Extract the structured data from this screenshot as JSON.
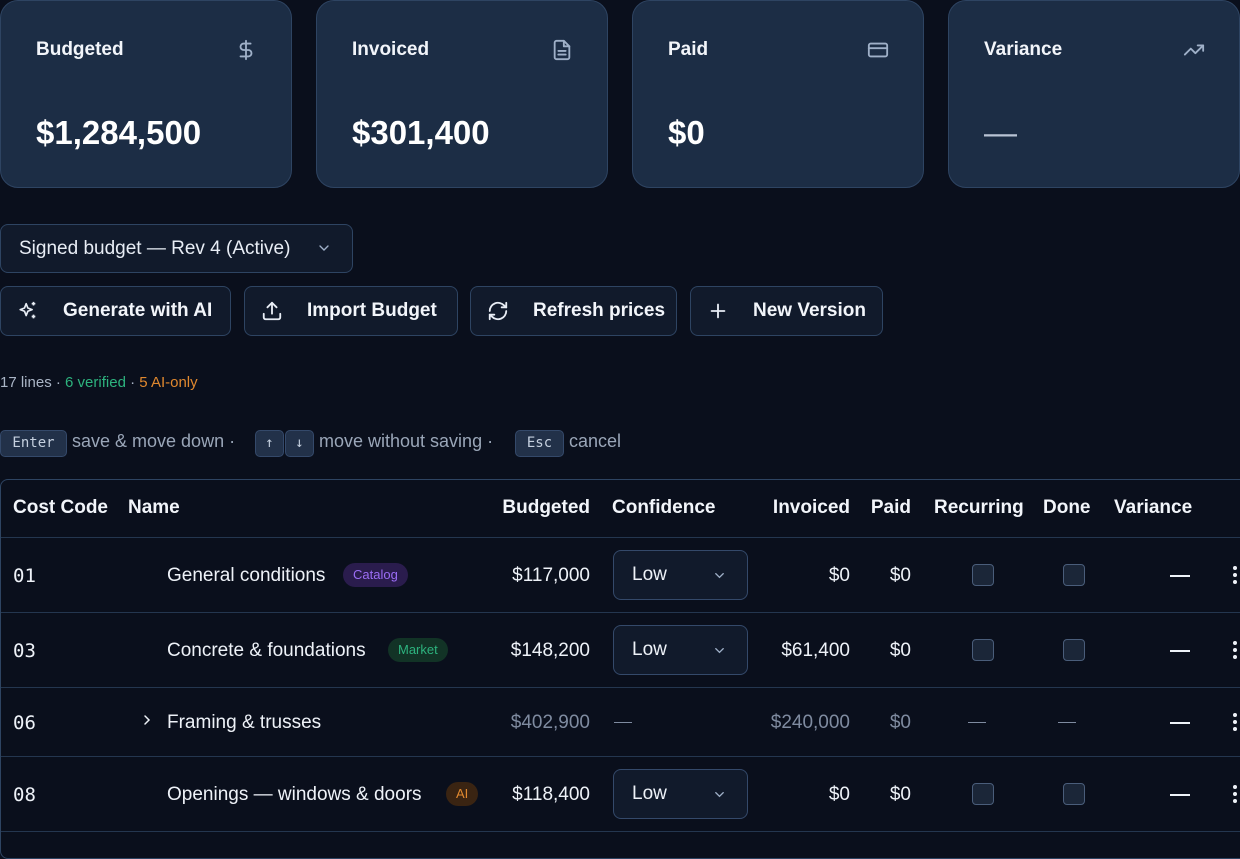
{
  "cards": [
    {
      "title": "Budgeted",
      "value": "$1,284,500",
      "icon": "dollar-icon"
    },
    {
      "title": "Invoiced",
      "value": "$301,400",
      "icon": "document-icon"
    },
    {
      "title": "Paid",
      "value": "$0",
      "icon": "credit-card-icon"
    },
    {
      "title": "Variance",
      "value": "—",
      "icon": "trending-up-icon"
    }
  ],
  "version_select": {
    "value": "Signed budget — Rev 4 (Active)"
  },
  "toolbar": {
    "generate": "Generate with AI",
    "import": "Import Budget",
    "refresh": "Refresh prices",
    "new_version": "New Version"
  },
  "summary": {
    "lines": "17 lines",
    "sep": " · ",
    "verified": "6 verified",
    "ai_only": "5 AI-only"
  },
  "hints": {
    "enter_key": "Enter",
    "enter_text": "save & move down ·",
    "up_key": "↑",
    "down_key": "↓",
    "move_text": "move without saving ·",
    "esc_key": "Esc",
    "esc_text": "cancel"
  },
  "table": {
    "headers": {
      "cost_code": "Cost Code",
      "name": "Name",
      "budgeted": "Budgeted",
      "confidence": "Confidence",
      "invoiced": "Invoiced",
      "paid": "Paid",
      "recurring": "Recurring",
      "done": "Done",
      "variance": "Variance"
    },
    "rows": [
      {
        "code": "01",
        "name": "General conditions",
        "badge": "Catalog",
        "budgeted": "$117,000",
        "confidence": "Low",
        "invoiced": "$0",
        "paid": "$0",
        "recurring": false,
        "done": false,
        "variance": "—"
      },
      {
        "code": "03",
        "name": "Concrete & foundations",
        "badge": "Market",
        "budgeted": "$148,200",
        "confidence": "Low",
        "invoiced": "$61,400",
        "paid": "$0",
        "recurring": false,
        "done": false,
        "variance": "—"
      },
      {
        "code": "06",
        "name": "Framing & trusses",
        "badge": "",
        "budgeted": "$402,900",
        "confidence": "—",
        "invoiced": "$240,000",
        "paid": "$0",
        "recurring": "—",
        "done": "—",
        "variance": "—",
        "group": true
      },
      {
        "code": "08",
        "name": "Openings — windows & doors",
        "badge": "AI",
        "budgeted": "$118,400",
        "confidence": "Low",
        "invoiced": "$0",
        "paid": "$0",
        "recurring": false,
        "done": false,
        "variance": "—"
      }
    ]
  },
  "colors": {
    "background": "#0a0f1c",
    "card": "#1c2d45",
    "catalog_badge": "#8b5cf6",
    "market_badge": "#2db37e",
    "ai_badge": "#e0882f"
  }
}
